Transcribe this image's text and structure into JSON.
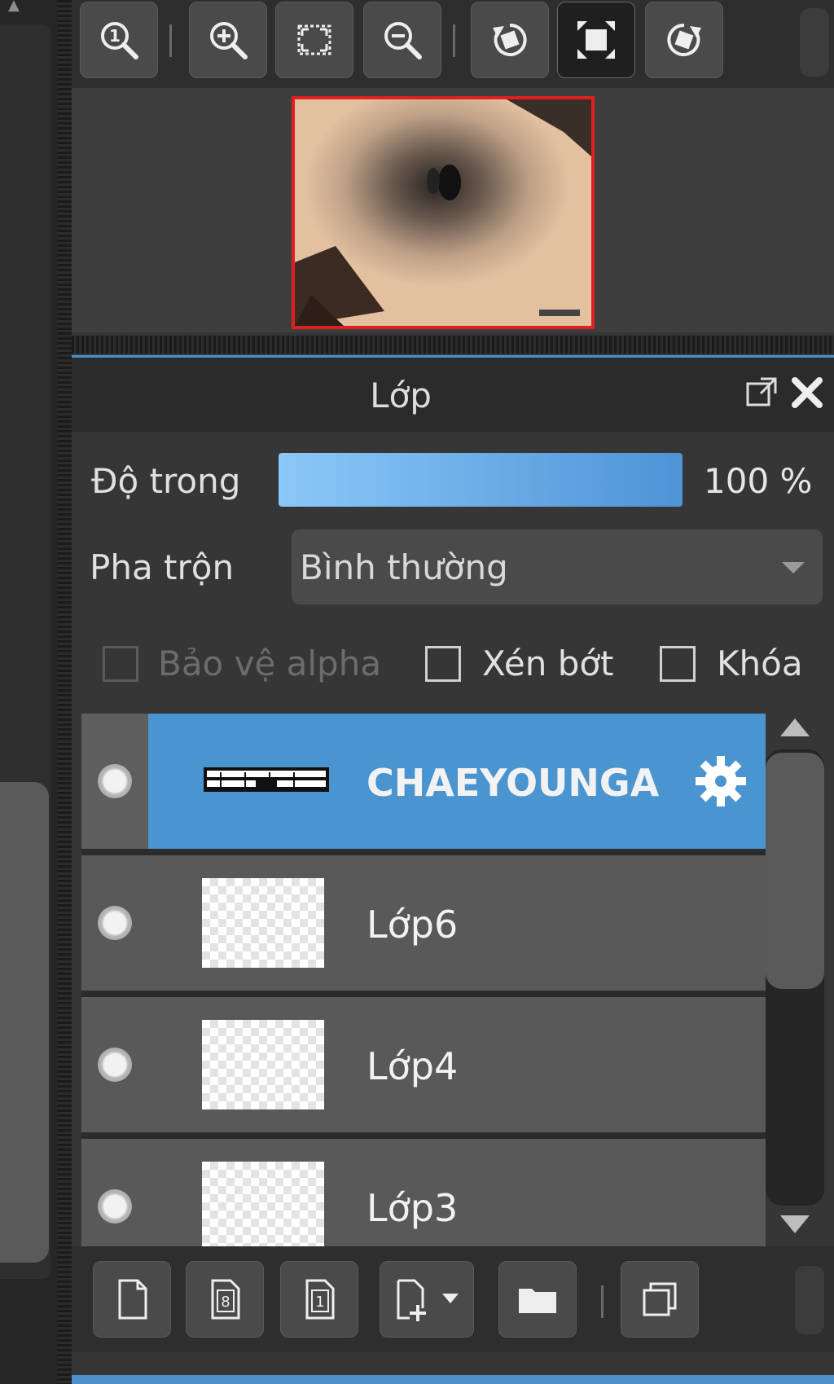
{
  "panel": {
    "title": "Lớp",
    "opacity_label": "Độ trong",
    "opacity_value_text": "100 %",
    "opacity_value": 100,
    "blend_label": "Pha trộn",
    "blend_value": "Bình thường",
    "checkboxes": {
      "protect_alpha": "Bảo vệ alpha",
      "clip": "Xén bớt",
      "lock": "Khóa"
    }
  },
  "layers": [
    {
      "name": "CHAEYOUNGA",
      "selected": true
    },
    {
      "name": "Lớp6",
      "selected": false
    },
    {
      "name": "Lớp4",
      "selected": false
    },
    {
      "name": "Lớp3",
      "selected": false
    }
  ],
  "colors": {
    "accent": "#4c8fca",
    "selected_row": "#4a94cf",
    "navigator_frame": "#e02020"
  },
  "toolbar_icons": [
    "zoom-actual-size-icon",
    "zoom-in-icon",
    "fit-to-window-icon",
    "zoom-out-icon",
    "rotate-left-icon",
    "fullscreen-icon",
    "rotate-right-icon"
  ],
  "bottom_icons": [
    "new-layer-icon",
    "new-8bit-layer-icon",
    "new-1bit-layer-icon",
    "add-layer-menu-icon",
    "new-folder-icon",
    "duplicate-layer-icon"
  ]
}
